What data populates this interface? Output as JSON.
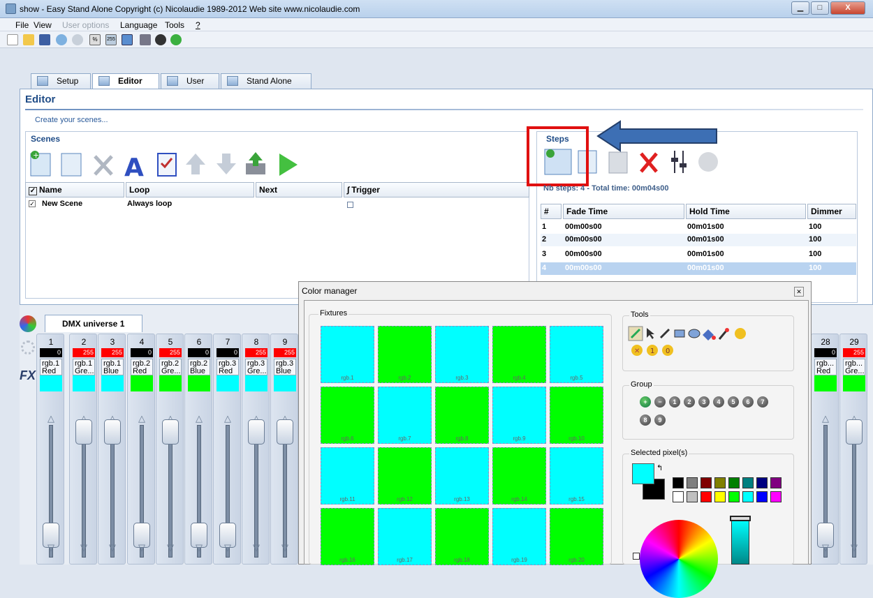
{
  "window": {
    "title": "show - Easy Stand Alone   Copyright (c) Nicolaudie 1989-2012   Web site www.nicolaudie.com"
  },
  "menu": [
    "File",
    "View",
    "User options",
    "Language",
    "Tools",
    "?"
  ],
  "tabs": [
    "Setup",
    "Editor",
    "User",
    "Stand Alone"
  ],
  "editor": {
    "title": "Editor",
    "subtitle": "Create your scenes..."
  },
  "scenes": {
    "title": "Scenes",
    "columns": [
      "Name",
      "Loop",
      "Next",
      "Trigger"
    ],
    "rows": [
      {
        "name": "New Scene",
        "loop": "Always loop",
        "next": ""
      }
    ]
  },
  "steps": {
    "title": "Steps",
    "summary": "Nb steps: 4 - Total time: 00m04s00",
    "columns": [
      "#",
      "Fade Time",
      "Hold Time",
      "Dimmer"
    ],
    "rows": [
      {
        "n": "1",
        "fade": "00m00s00",
        "hold": "00m01s00",
        "dimmer": "100"
      },
      {
        "n": "2",
        "fade": "00m00s00",
        "hold": "00m01s00",
        "dimmer": "100"
      },
      {
        "n": "3",
        "fade": "00m00s00",
        "hold": "00m01s00",
        "dimmer": "100"
      },
      {
        "n": "4",
        "fade": "00m00s00",
        "hold": "00m01s00",
        "dimmer": "100"
      }
    ]
  },
  "dmx": {
    "tab": "DMX universe 1",
    "channels": [
      {
        "num": "1",
        "value": "0",
        "name": "rgb.1 Red",
        "color": "#00ffff"
      },
      {
        "num": "2",
        "value": "255",
        "name": "rgb.1 Gre...",
        "color": "#00ffff"
      },
      {
        "num": "3",
        "value": "255",
        "name": "rgb.1 Blue",
        "color": "#00ffff"
      },
      {
        "num": "4",
        "value": "0",
        "name": "rgb.2 Red",
        "color": "#00ff00"
      },
      {
        "num": "5",
        "value": "255",
        "name": "rgb.2 Gre...",
        "color": "#00ff00"
      },
      {
        "num": "6",
        "value": "0",
        "name": "rgb.2 Blue",
        "color": "#00ff00"
      },
      {
        "num": "7",
        "value": "0",
        "name": "rgb.3 Red",
        "color": "#00ffff"
      },
      {
        "num": "8",
        "value": "255",
        "name": "rgb.3 Gre...",
        "color": "#00ffff"
      },
      {
        "num": "9",
        "value": "255",
        "name": "rgb.3 Blue",
        "color": "#00ffff"
      },
      {
        "num": "28",
        "value": "0",
        "name": "rgb... Red",
        "color": "#00ff00"
      },
      {
        "num": "29",
        "value": "255",
        "name": "rgb... Gre...",
        "color": "#00ff00"
      }
    ]
  },
  "color_manager": {
    "title": "Color manager",
    "fixtures_label": "Fixtures",
    "tools_label": "Tools",
    "group_label": "Group",
    "selected_label": "Selected pixel(s)",
    "fixtures": [
      {
        "label": "rgb.1",
        "color": "#00ffff"
      },
      {
        "label": "rgb.2",
        "color": "#00ff00"
      },
      {
        "label": "rgb.3",
        "color": "#00ffff"
      },
      {
        "label": "rgb.4",
        "color": "#00ff00"
      },
      {
        "label": "rgb.5",
        "color": "#00ffff"
      },
      {
        "label": "rgb.6",
        "color": "#00ff00"
      },
      {
        "label": "rgb.7",
        "color": "#00ffff"
      },
      {
        "label": "rgb.8",
        "color": "#00ff00"
      },
      {
        "label": "rgb.9",
        "color": "#00ffff"
      },
      {
        "label": "rgb.10",
        "color": "#00ff00"
      },
      {
        "label": "rgb.11",
        "color": "#00ffff"
      },
      {
        "label": "rgb.12",
        "color": "#00ff00"
      },
      {
        "label": "rgb.13",
        "color": "#00ffff"
      },
      {
        "label": "rgb.14",
        "color": "#00ff00"
      },
      {
        "label": "rgb.15",
        "color": "#00ffff"
      },
      {
        "label": "rgb.16",
        "color": "#00ff00"
      },
      {
        "label": "rgb.17",
        "color": "#00ffff"
      },
      {
        "label": "rgb.18",
        "color": "#00ff00"
      },
      {
        "label": "rgb.19",
        "color": "#00ffff"
      },
      {
        "label": "rgb.20",
        "color": "#00ff00"
      }
    ],
    "groups": [
      "+",
      "−",
      "1",
      "2",
      "3",
      "4",
      "5",
      "6",
      "7",
      "8",
      "9"
    ],
    "palette": [
      "#000000",
      "#808080",
      "#800000",
      "#808000",
      "#008000",
      "#008080",
      "#000080",
      "#800080",
      "#ffffff",
      "#c0c0c0",
      "#ff0000",
      "#ffff00",
      "#00ff00",
      "#00ffff",
      "#0000ff",
      "#ff00ff"
    ]
  }
}
